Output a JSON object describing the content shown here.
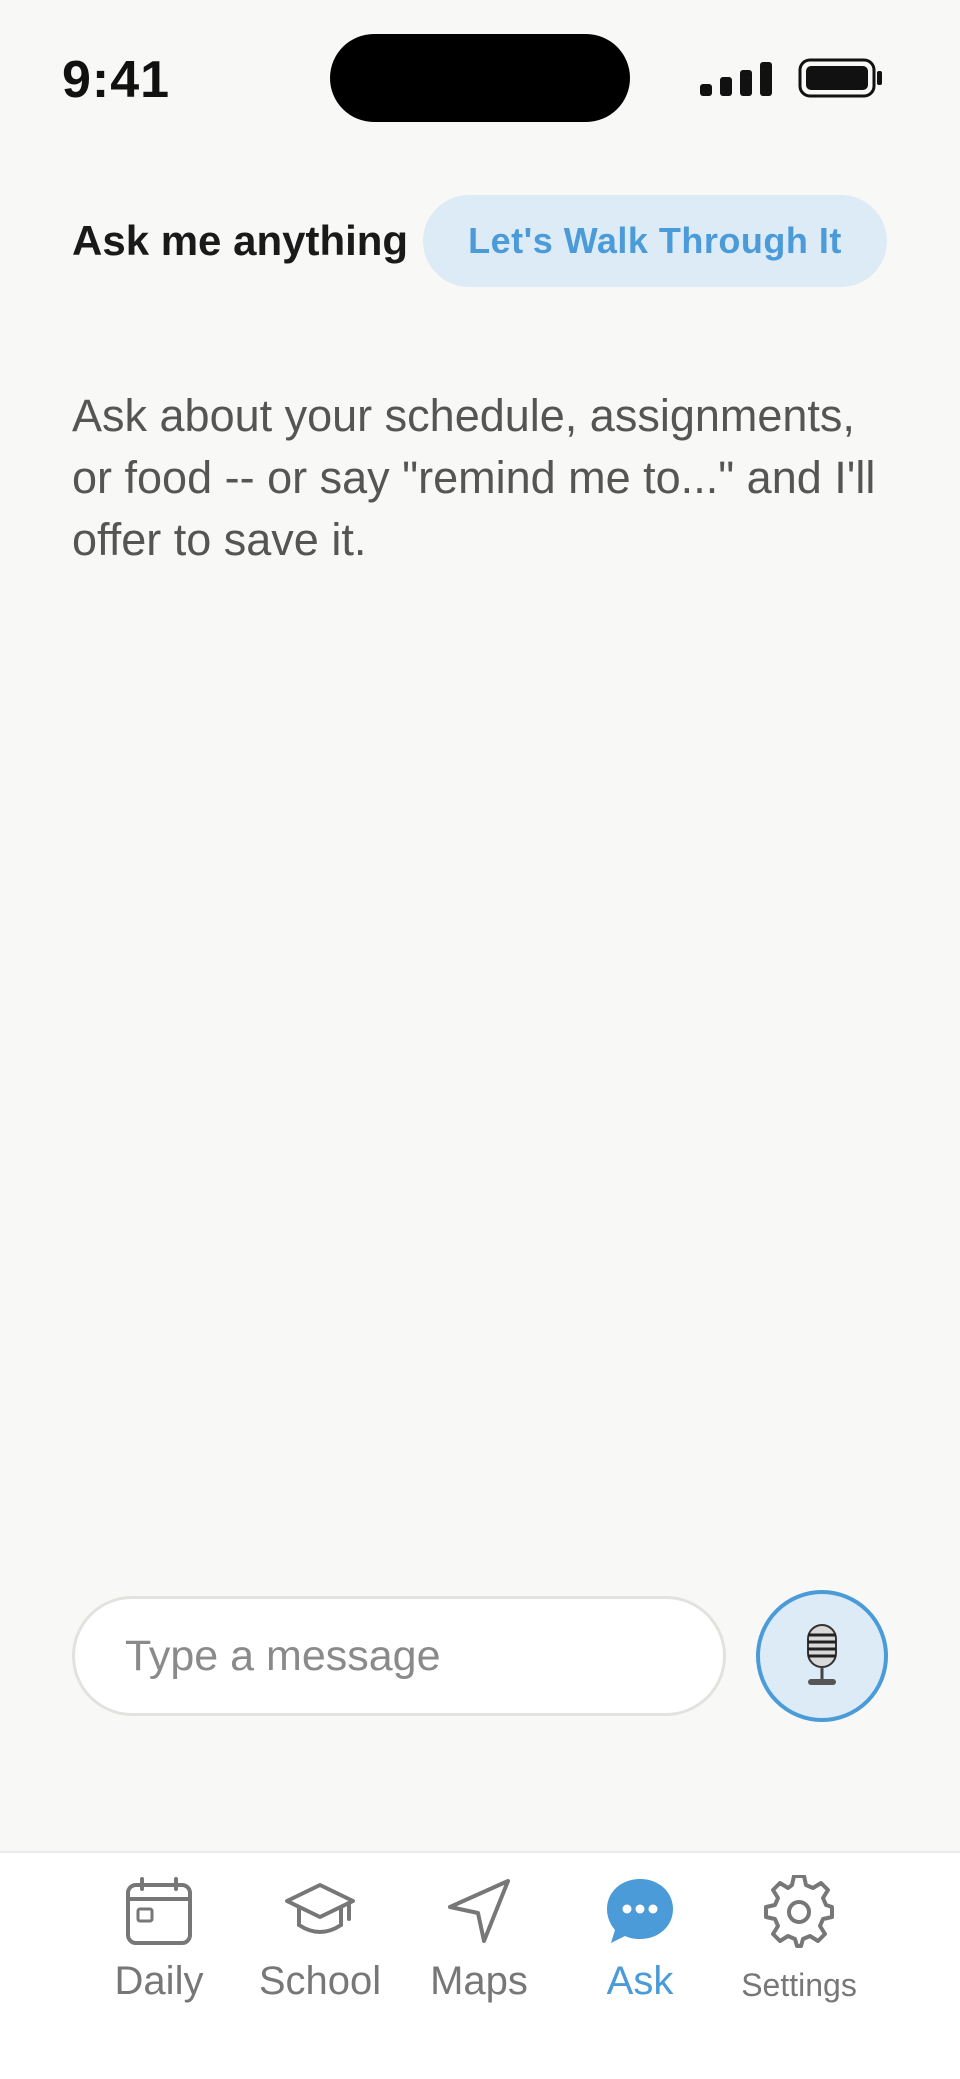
{
  "status_bar": {
    "time": "9:41",
    "signal_icon": "cellular-signal-icon",
    "battery_icon": "battery-full-icon"
  },
  "header": {
    "title": "Ask me anything",
    "walk_through_label": "Let's Walk Through It"
  },
  "intro": {
    "text": "Ask about your schedule, assignments, or food -- or say \"remind me to...\" and I'll offer to save it."
  },
  "composer": {
    "placeholder": "Type a message",
    "value": "",
    "mic_icon": "microphone-icon"
  },
  "tab_bar": {
    "active": "Ask",
    "accent_color": "#4a9bd8",
    "items": [
      {
        "label": "Daily",
        "icon": "calendar-icon"
      },
      {
        "label": "School",
        "icon": "graduation-cap-icon"
      },
      {
        "label": "Maps",
        "icon": "navigation-arrow-icon"
      },
      {
        "label": "Ask",
        "icon": "chat-bubble-icon"
      },
      {
        "label": "Settings",
        "icon": "gear-icon"
      }
    ]
  }
}
